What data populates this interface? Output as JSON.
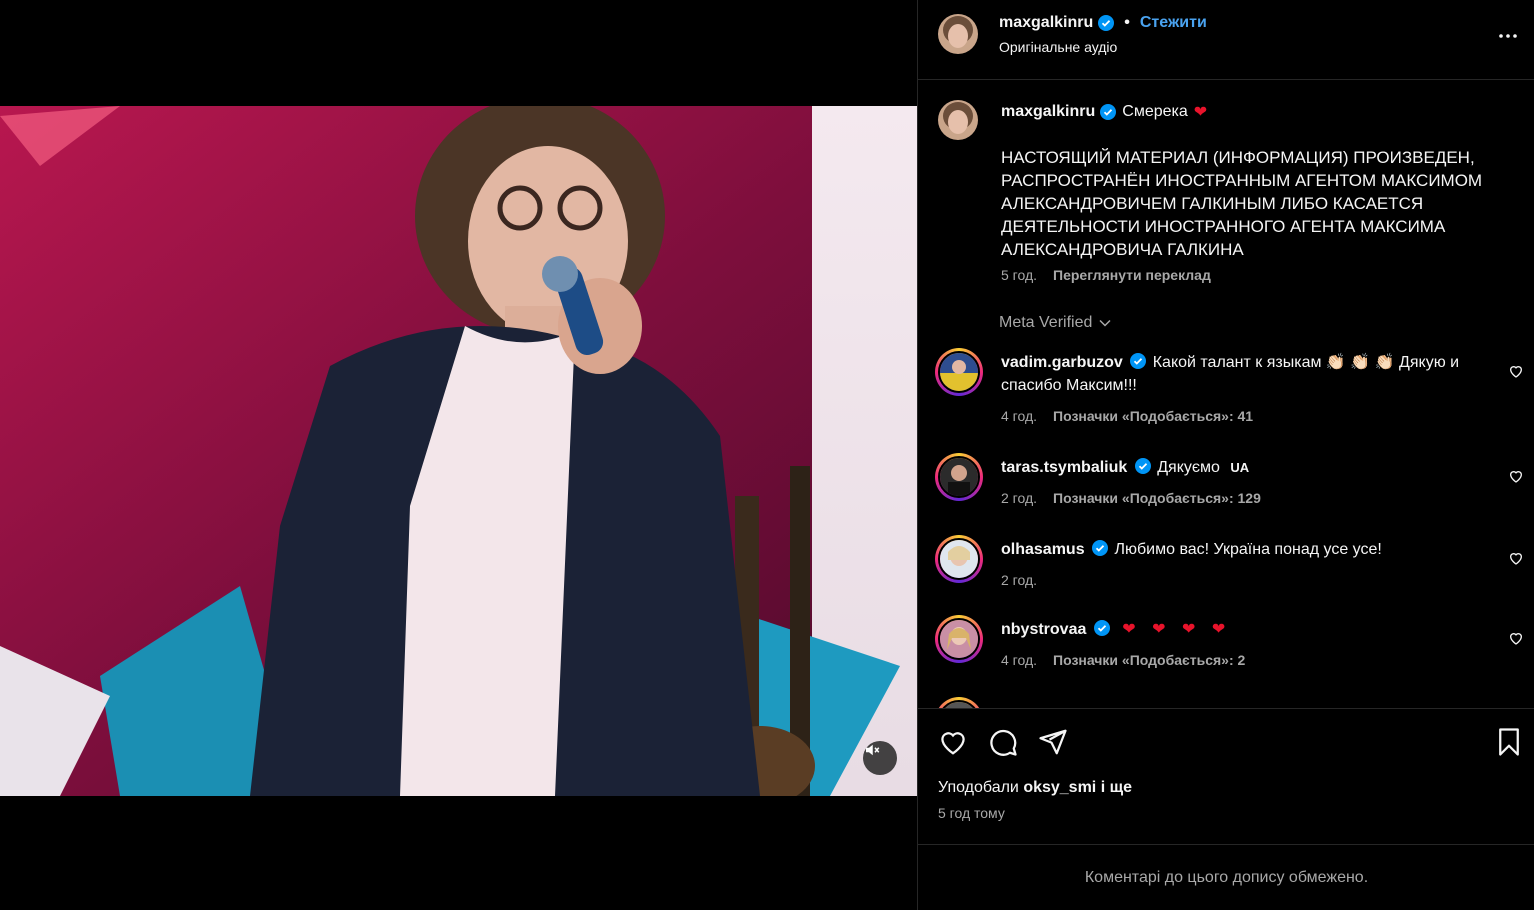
{
  "post": {
    "username": "maxgalkinru",
    "follow_label": "Стежити",
    "separator": "•",
    "audio": "Оригінальне аудіо"
  },
  "caption": {
    "username": "maxgalkinru",
    "text": "Смерека",
    "emoji": "❤",
    "body": "НАСТОЯЩИЙ МАТЕРИАЛ (ИНФОРМАЦИЯ) ПРОИЗВЕДЕН, РАСПРОСТРАНЁН ИНОСТРАННЫМ АГЕНТОМ МАКСИМОМ АЛЕКСАНДРОВИЧЕМ ГАЛКИНЫМ ЛИБО КАСАЕТСЯ ДЕЯТЕЛЬНОСТИ ИНОСТРАННОГО АГЕНТА МАКСИМА АЛЕКСАНДРОВИЧА ГАЛКИНА",
    "time": "5 год.",
    "translate_label": "Переглянути переклад"
  },
  "meta_verified_label": "Meta Verified",
  "comments": [
    {
      "username": "vadim.garbuzov",
      "text": "Какой талант к языкам 👏🏻 👏🏻 👏🏻 Дякую и спасибо Максим!!!",
      "time": "4 год.",
      "likes": "Позначки «Подобається»: 41"
    },
    {
      "username": "taras.tsymbaliuk",
      "text": "Дякуємо",
      "flag": "UA",
      "time": "2 год.",
      "likes": "Позначки «Подобається»: 129"
    },
    {
      "username": "olhasamus",
      "text": "Любимо вас! Україна понад усе усе!",
      "time": "2 год.",
      "likes": ""
    },
    {
      "username": "nbystrovaa",
      "text": "❤ ❤ ❤ ❤",
      "time": "4 год.",
      "likes": "Позначки «Подобається»: 2"
    }
  ],
  "likes_summary": {
    "prefix": "Уподобали",
    "user": "oksy_smi",
    "suffix": "і ще"
  },
  "post_time": "5 год тому",
  "footer_text": "Коментарі до цього допису обмежено.",
  "colors": {
    "link": "#4aa3f0",
    "verified": "#0095f6",
    "heart": "#e8132b",
    "muted": "#a8a8a8"
  },
  "icons": [
    "verified-badge-icon",
    "more-options-icon",
    "chevron-down-icon",
    "heart-outline-icon",
    "comment-icon",
    "share-icon",
    "bookmark-icon",
    "mute-icon"
  ]
}
